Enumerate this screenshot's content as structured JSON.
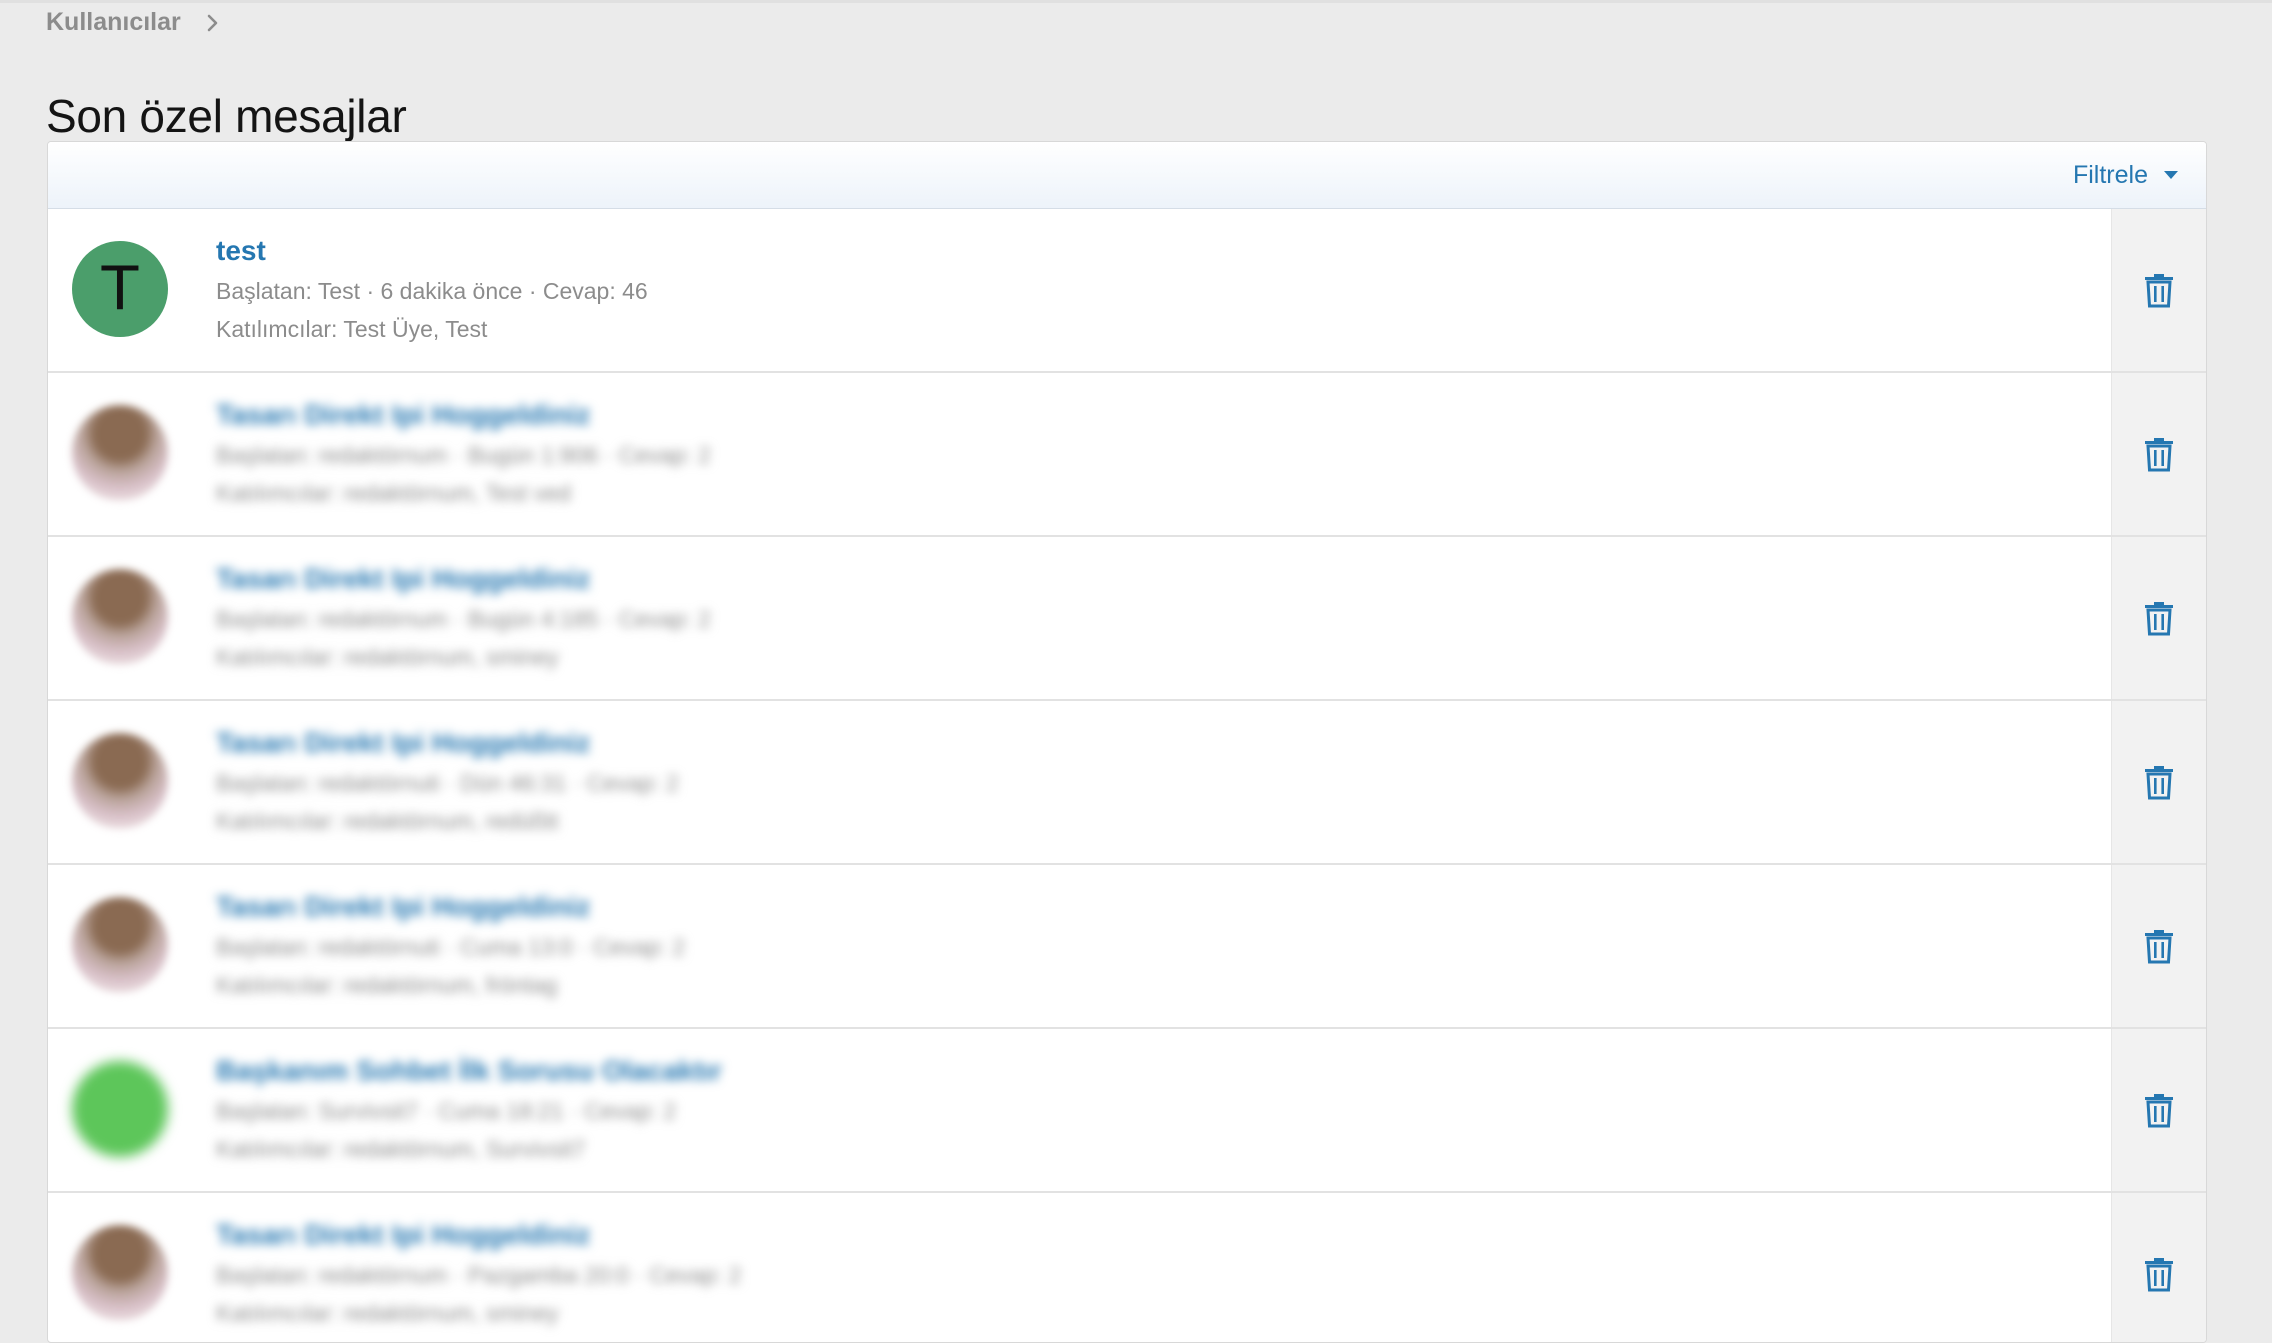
{
  "breadcrumb": {
    "label": "Kullanıcılar"
  },
  "page": {
    "title": "Son özel mesajlar"
  },
  "filter": {
    "label": "Filtrele"
  },
  "colors": {
    "link": "#2577b1",
    "meta": "#8c8c8c",
    "avatar_green": "#4b9e6b"
  },
  "conversations": [
    {
      "title": "test",
      "meta": "Başlatan: Test · 6 dakika önce · Cevap: 46",
      "participants": "Katılımcılar: Test Üye, Test",
      "avatar_letter": "T"
    },
    {
      "title": "Tasarı Direkt Ipi Hoggeldiniz",
      "meta": "Başlatan: redaktörnum · Bugün 1:906 · Cevap: 2",
      "participants": "Katılımcılar: redaktörnum, Test ved"
    },
    {
      "title": "Tasarı Direkt Ipi Hoggeldiniz",
      "meta": "Başlatan: redaktörnum · Bugün 4:185 · Cevap: 2",
      "participants": "Katılımcılar: redaktörnum, sminey"
    },
    {
      "title": "Tasarı Direkt Ipi Hoggeldiniz",
      "meta": "Başlatan: redaktörnuti · Dün 46:31 · Cevap: 2",
      "participants": "Katılımcılar: redaktörnum, redüßtt"
    },
    {
      "title": "Tasarı Direkt Ipi Hoggeldiniz",
      "meta": "Başlatan: redaktörnuti · Cuma 13:0 · Cevap: 2",
      "participants": "Katılımcılar: redaktörnum, fröntag"
    },
    {
      "title": "Başkanım Sohbet İlk Sorusu Olacaktır",
      "meta": "Başlatan: Survivsit7 · Cuma 18:21 · Cevap: 2",
      "participants": "Katılımcılar: redaktörnum, Survivsit7"
    },
    {
      "title": "Tasarı Direkt Ipi Hoggeldiniz",
      "meta": "Başlatan: redaktörnum · Pazgamba 20:0 · Cevap: 2",
      "participants": "Katılımcılar: redaktörnum, sminey"
    }
  ]
}
